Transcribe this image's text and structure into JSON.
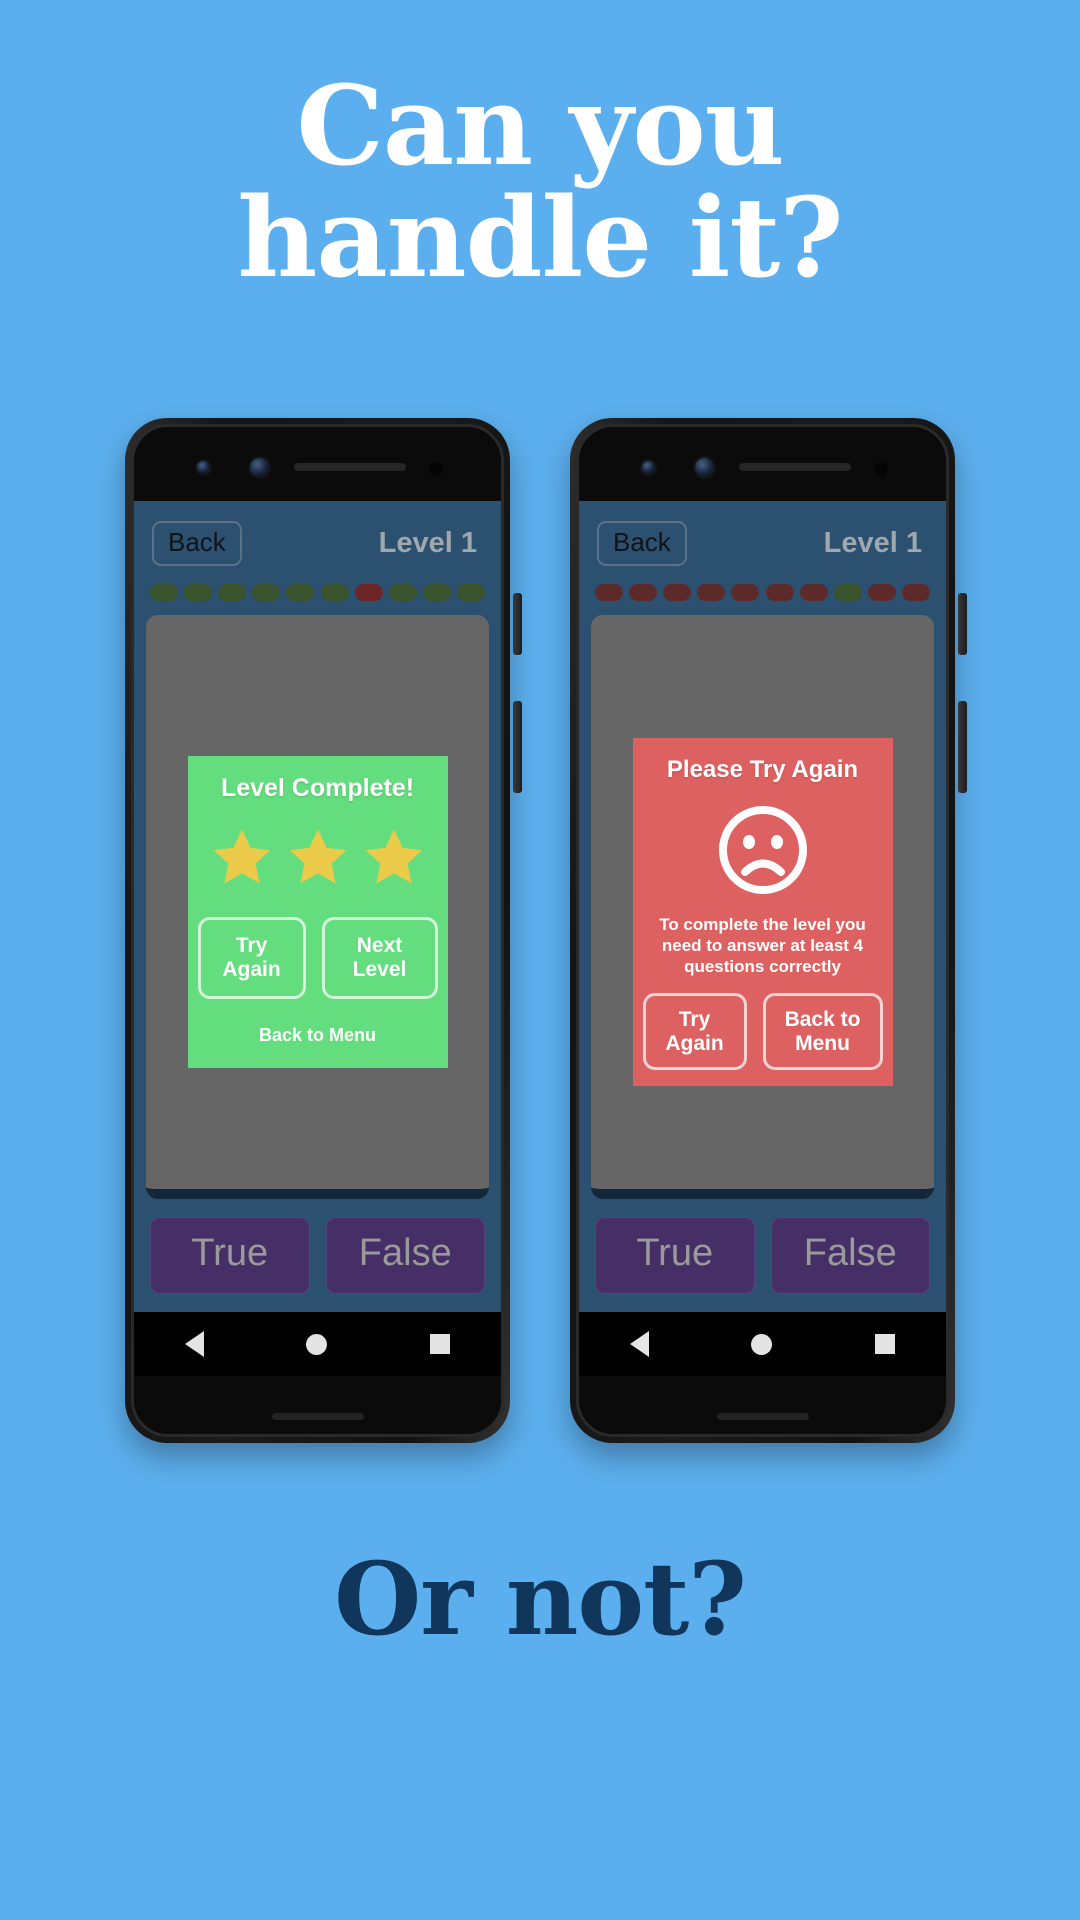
{
  "theme": {
    "background": "#5cafee",
    "headline_color": "#ffffff",
    "footline_color": "#10365c",
    "app_background": "#2b5070",
    "quiz_panel": "#666666",
    "success_card": "#63dd7d",
    "fail_card": "#de6161",
    "answer_button": "#462f66",
    "star_color": "#eccb4b",
    "dot_green": "#39532c",
    "dot_red": "#6d2424"
  },
  "headline": {
    "line1": "Can you",
    "line2": "handle it?"
  },
  "footline": {
    "text": "Or not?"
  },
  "phones": [
    {
      "id": "phone-success",
      "topbar": {
        "back_label": "Back",
        "level_label": "Level 1"
      },
      "progress": {
        "dots": [
          "g",
          "g",
          "g",
          "g",
          "g",
          "g",
          "r",
          "g",
          "g",
          "g"
        ]
      },
      "result": {
        "variant": "success",
        "title": "Level Complete!",
        "stars": 3,
        "buttons": [
          {
            "label": "Try Again",
            "name": "try-again-button"
          },
          {
            "label": "Next Level",
            "name": "next-level-button"
          }
        ],
        "link_label": "Back to Menu"
      },
      "answers": [
        {
          "label": "True",
          "name": "true-button"
        },
        {
          "label": "False",
          "name": "false-button"
        }
      ],
      "navbar": {
        "back": "nav-back-icon",
        "home": "nav-home-icon",
        "recent": "nav-recent-icon"
      }
    },
    {
      "id": "phone-fail",
      "topbar": {
        "back_label": "Back",
        "level_label": "Level 1"
      },
      "progress": {
        "dots": [
          "r",
          "r",
          "r",
          "r",
          "r",
          "r",
          "r",
          "g",
          "r",
          "r"
        ]
      },
      "result": {
        "variant": "fail",
        "title": "Please Try Again",
        "icon": "sad-face-icon",
        "message": "To complete the level you need to answer at least 4 questions correctly",
        "buttons": [
          {
            "label": "Try Again",
            "name": "try-again-button"
          },
          {
            "label": "Back to Menu",
            "name": "back-to-menu-button"
          }
        ]
      },
      "answers": [
        {
          "label": "True",
          "name": "true-button"
        },
        {
          "label": "False",
          "name": "false-button"
        }
      ],
      "navbar": {
        "back": "nav-back-icon",
        "home": "nav-home-icon",
        "recent": "nav-recent-icon"
      }
    }
  ]
}
